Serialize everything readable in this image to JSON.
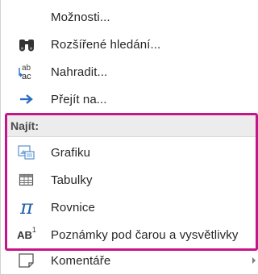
{
  "menu": {
    "items": [
      {
        "label": "Možnosti..."
      },
      {
        "label": "Rozšířené hledání..."
      },
      {
        "label": "Nahradit..."
      },
      {
        "label": "Přejít na..."
      }
    ],
    "group": {
      "title": "Najít:",
      "items": [
        {
          "label": "Grafiku"
        },
        {
          "label": "Tabulky"
        },
        {
          "label": "Rovnice"
        },
        {
          "label": "Poznámky pod čarou a vysvětlivky"
        },
        {
          "label": "Komentáře"
        }
      ]
    },
    "icons": {
      "replace_top": "ab",
      "replace_bottom": "ac",
      "equation": "π",
      "footnote_main": "AB",
      "footnote_sup": "1"
    },
    "colors": {
      "highlight_frame": "#c6158a",
      "arrow_blue": "#2b6cc4",
      "equation_blue": "#1f5fa8"
    }
  }
}
